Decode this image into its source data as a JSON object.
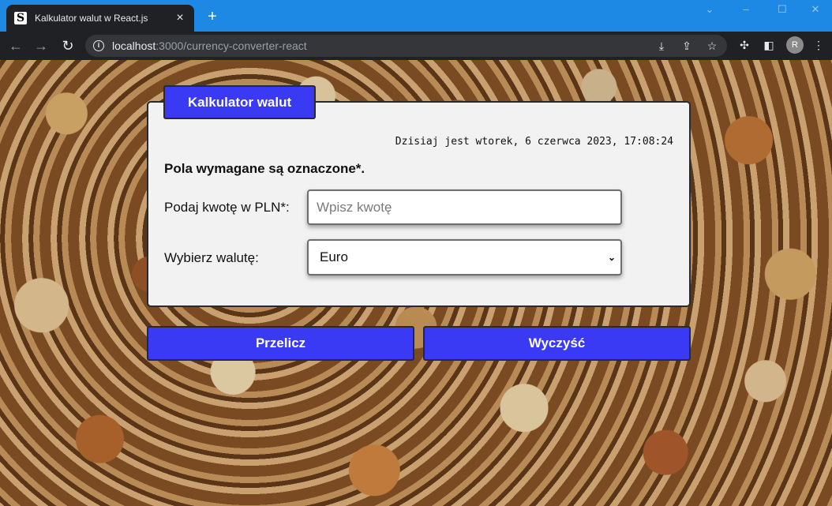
{
  "browser": {
    "tab_title": "Kalkulator walut w React.js",
    "favicon_letter": "S",
    "url_host": "localhost",
    "url_path": ":3000/currency-converter-react",
    "profile_initial": "R"
  },
  "app": {
    "title": "Kalkulator walut",
    "date_text": "Dzisiaj jest wtorek, 6 czerwca 2023, 17:08:24",
    "required_note": "Pola wymagane są oznaczone*.",
    "amount_label": "Podaj kwotę w PLN*:",
    "amount_placeholder": "Wpisz kwotę",
    "amount_value": "",
    "currency_label": "Wybierz walutę:",
    "currency_selected": "Euro",
    "convert_button": "Przelicz",
    "clear_button": "Wyczyść"
  },
  "colors": {
    "accent": "#3a3af5",
    "titlebar": "#1e88e5",
    "card_bg": "#f2f2f2"
  }
}
